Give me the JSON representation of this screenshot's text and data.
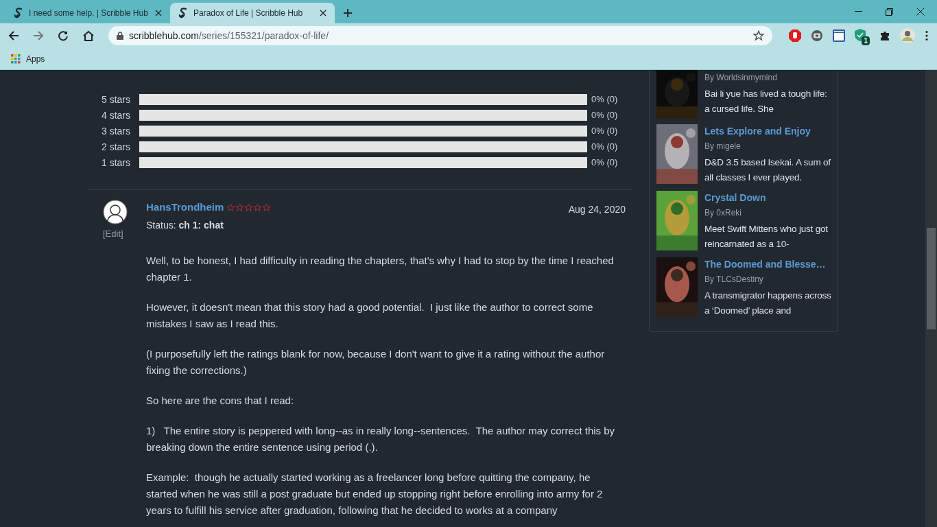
{
  "tabs": [
    {
      "title": "I need some help. | Scribble Hub",
      "selected": false
    },
    {
      "title": "Paradox of Life | Scribble Hub",
      "selected": true
    }
  ],
  "address": {
    "domain": "scribblehub.com",
    "path": "/series/155321/paradox-of-life/"
  },
  "extension_badge": "1",
  "bookmarks": [
    {
      "label": "Apps"
    }
  ],
  "ratings": [
    {
      "label": "5 stars",
      "level": 0,
      "reading": "0% (0)"
    },
    {
      "label": "4 stars",
      "level": 0,
      "reading": "0% (0)"
    },
    {
      "label": "3 stars",
      "level": 0,
      "reading": "0% (0)"
    },
    {
      "label": "2 stars",
      "level": 0,
      "reading": "0% (0)"
    },
    {
      "label": "1 stars",
      "level": 0,
      "reading": "0% (0)"
    }
  ],
  "review": {
    "user": "HansTrondheim",
    "stars": 0,
    "status_label": "Status:",
    "status": "ch 1: chat",
    "edit": "[Edit]",
    "date": "Aug 24, 2020",
    "paragraphs": [
      "Well, to be honest, I had difficulty in reading the chapters, that's why I had to stop by the time I reached chapter 1.",
      "However, it doesn't mean that this story had a good potential.  I just like the author to correct some mistakes I saw as I read this.",
      "(I purposefully left the ratings blank for now, because I don't want to give it a rating without the author fixing the corrections.)",
      "So here are the cons that I read:",
      "1)   The entire story is peppered with long--as in really long--sentences.  The author may correct this by breaking down the entire sentence using period (.).",
      "Example:  though he actually started working as a freelancer long before quitting the company, he started when he was still a post graduate but ended up stopping right before enrolling into army for 2 years to fulfill his service after graduation, following that he decided to works at a company"
    ]
  },
  "sidebar": [
    {
      "author": "By Worldsinmymind",
      "description": "Bai li yue has lived a tough life: a cursed life. She"
    },
    {
      "title": "Lets Explore and Enjoy",
      "author": "By migele",
      "description": "D&D 3.5 based Isekai. A sum of all classes I ever played."
    },
    {
      "title": "Crystal Down",
      "author": "By 0xReki",
      "description": "Meet Swift Mittens who just got reincarnated as a 10-"
    },
    {
      "title": "The Doomed and Blesse…",
      "author": "By TLCsDestiny",
      "description": "A transmigrator happens across a ‘Doomed’ place and"
    }
  ]
}
